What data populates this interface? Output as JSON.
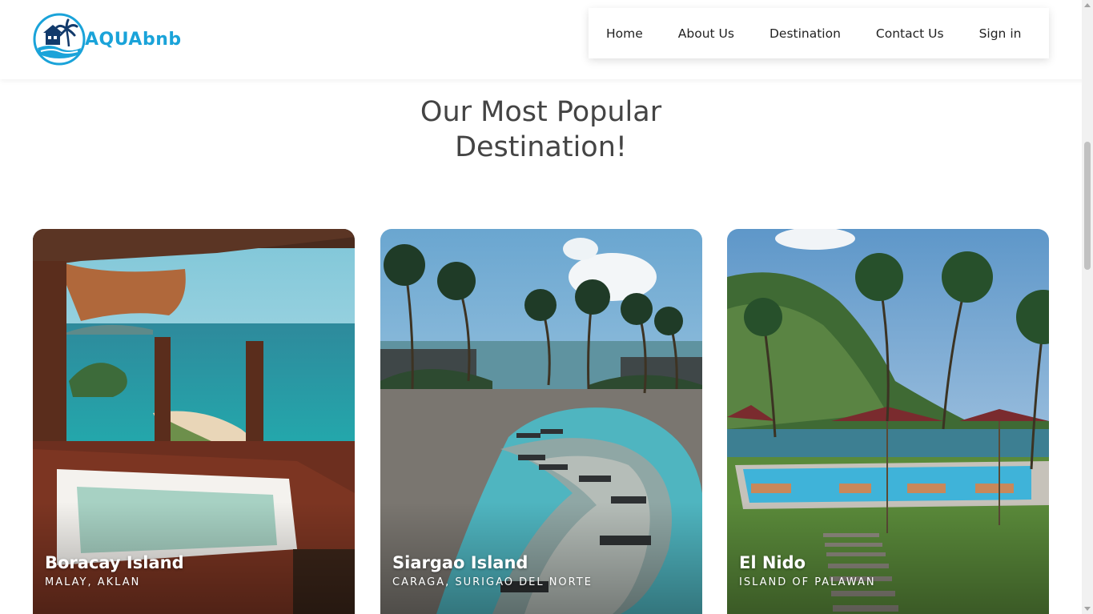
{
  "brand": {
    "name": "AQUAbnb",
    "color": "#1aa3d9"
  },
  "nav": {
    "items": [
      {
        "label": "Home"
      },
      {
        "label": "About Us"
      },
      {
        "label": "Destination"
      },
      {
        "label": "Contact Us"
      },
      {
        "label": "Sign in"
      }
    ]
  },
  "section": {
    "title_line1": "Our Most Popular",
    "title_line2": "Destination!"
  },
  "cards": [
    {
      "title": "Boracay Island",
      "subtitle": "MALAY, AKLAN",
      "image": "hot-tub-overlooking-beach-photo"
    },
    {
      "title": "Siargao Island",
      "subtitle": "CARAGA, SURIGAO DEL NORTE",
      "image": "resort-pool-palm-trees-photo"
    },
    {
      "title": "El Nido",
      "subtitle": "ISLAND OF PALAWAN",
      "image": "resort-pool-mountain-photo"
    }
  ]
}
